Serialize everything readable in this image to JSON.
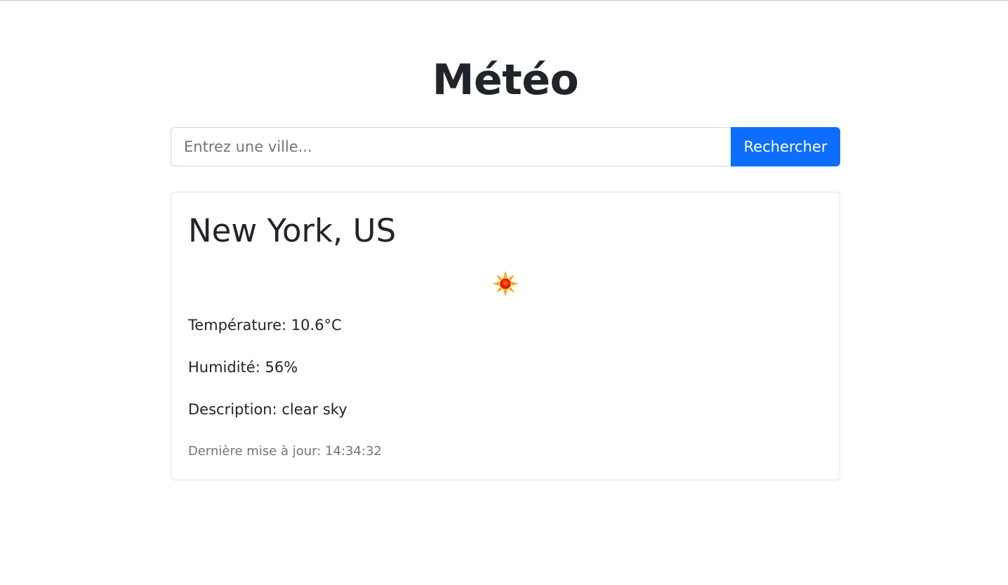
{
  "page": {
    "title": "Météo"
  },
  "search": {
    "placeholder": "Entrez une ville...",
    "value": "",
    "button_label": "Rechercher"
  },
  "weather": {
    "city": "New York, US",
    "icon": "sun-icon",
    "temperature_label": "Température:",
    "temperature_value": "10.6°C",
    "humidity_label": "Humidité:",
    "humidity_value": "56%",
    "description_label": "Description:",
    "description_value": "clear sky",
    "updated_label": "Dernière mise à jour:",
    "updated_value": "14:34:32"
  },
  "colors": {
    "accent": "#0d6efd",
    "text": "#212529",
    "muted": "#6c757d",
    "border": "#dee2e6"
  }
}
